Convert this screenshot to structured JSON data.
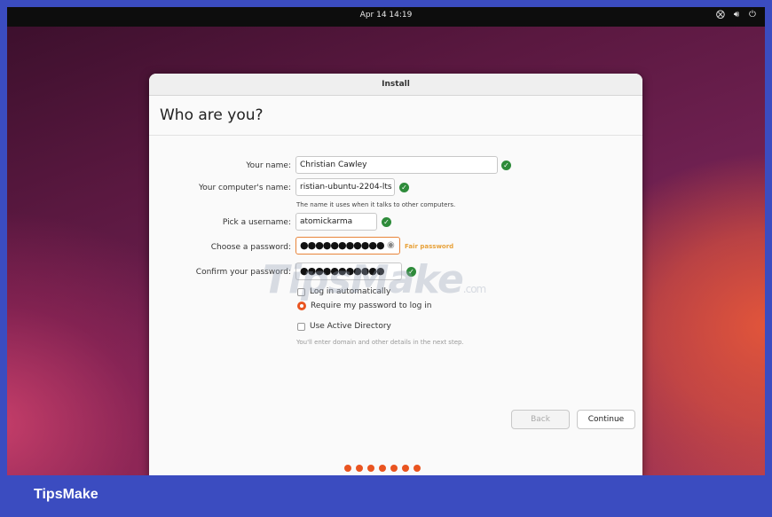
{
  "topbar": {
    "clock": "Apr 14  14:19",
    "tray_icons": [
      "network-icon",
      "volume-icon",
      "power-icon"
    ]
  },
  "dialog": {
    "title": "Install",
    "heading": "Who are you?",
    "fields": {
      "name": {
        "label": "Your name:",
        "value": "Christian Cawley"
      },
      "computer": {
        "label": "Your computer's name:",
        "value": "ristian-ubuntu-2204-lts",
        "hint": "The name it uses when it talks to other computers."
      },
      "username": {
        "label": "Pick a username:",
        "value": "atomickarma"
      },
      "password": {
        "label": "Choose a password:",
        "value": "●●●●●●●●●●●",
        "strength": "Fair password"
      },
      "confirm": {
        "label": "Confirm your password:",
        "value": "●●●●●●●●●●●"
      }
    },
    "options": {
      "login_auto": "Log in automatically",
      "require_password": "Require my password to log in",
      "active_directory": "Use Active Directory",
      "ad_hint": "You'll enter domain and other details in the next step."
    },
    "buttons": {
      "back": "Back",
      "continue": "Continue"
    }
  },
  "watermark": {
    "text": "TipsMake",
    "suffix": ".com"
  },
  "footer": {
    "brand": "TipsMake"
  },
  "colors": {
    "accent": "#e95420",
    "success": "#2e8b3a",
    "frame": "#3b4cc0"
  }
}
